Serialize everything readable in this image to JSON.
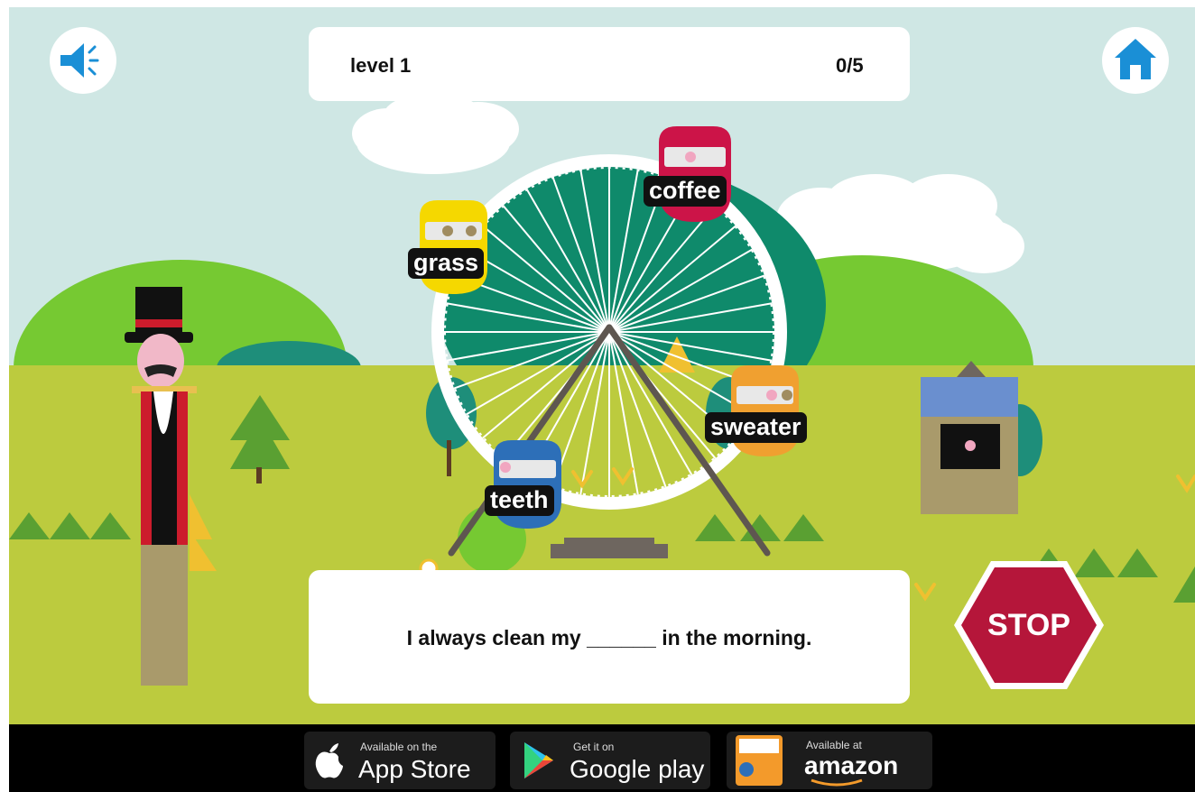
{
  "header": {
    "level_label": "level 1",
    "score_label": "0/5"
  },
  "buttons": {
    "sound_icon": "speaker-icon",
    "home_icon": "home-icon",
    "stop_label": "STOP"
  },
  "words": [
    {
      "label": "coffee",
      "color": "#cc1448"
    },
    {
      "label": "grass",
      "color": "#f5d800"
    },
    {
      "label": "sweater",
      "color": "#f0a030"
    },
    {
      "label": "teeth",
      "color": "#2d6fb8"
    }
  ],
  "question": {
    "sentence": "I always clean my ______ in the morning."
  },
  "stores": {
    "appstore_small": "Available on the",
    "appstore_big": "App Store",
    "googleplay_small": "Get it on",
    "googleplay_big": "Google play",
    "amazon_small": "Available at",
    "amazon_big": "amazon"
  },
  "colors": {
    "sky": "#cfe7e4",
    "grass": "#bccb3e",
    "hill": "#76c932",
    "wheel_bg": "#0f8a6b",
    "accent_blue": "#1a8fd6",
    "stop": "#b5163a"
  }
}
